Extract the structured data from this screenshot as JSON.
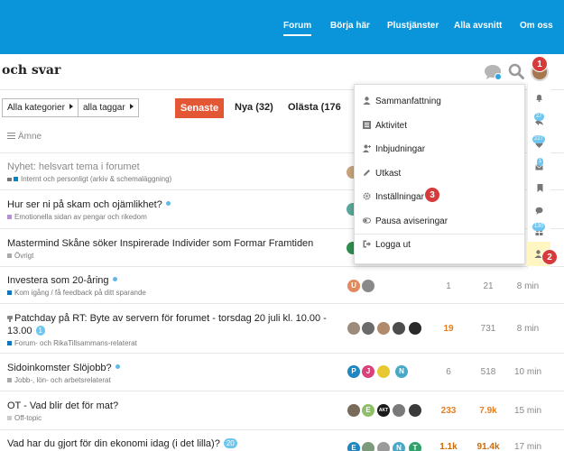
{
  "nav": {
    "links": [
      "Forum",
      "Börja här",
      "Plustjänster",
      "Alla avsnitt",
      "Om oss"
    ]
  },
  "header": {
    "site_title": "och svar"
  },
  "filters": {
    "categories": "Alla kategorier",
    "tags": "alla taggar"
  },
  "tabs": {
    "latest": "Senaste",
    "new": "Nya (32)",
    "unread": "Olästa (176"
  },
  "columns": {
    "topic": "Ämne"
  },
  "topics": [
    {
      "title": "Nyhet: helsvart tema i forumet",
      "category": "Internt och personligt (arkiv & schemaläggning)",
      "category_color": "#0088cc",
      "muted": true
    },
    {
      "title": "Hur ser ni på skam och ojämlikhet?",
      "category": "Emotionella sidan av pengar och rikedom",
      "category_color": "#b491d1"
    },
    {
      "title": "Mastermind Skåne söker Inspirerade Individer som Formar Framtiden",
      "category": "Övrigt",
      "category_color": "#aaaaaa"
    },
    {
      "title": "Investera som 20-åring",
      "category": "Kom igång / få feedback på ditt sparande",
      "category_color": "#0e76bd",
      "replies": "1",
      "views": "21",
      "activity": "8 min",
      "avatars": [
        "U",
        ""
      ]
    },
    {
      "title_line1": "Patchday på RT: Byte av servern för forumet - torsdag 20 juli kl. 10.00 -",
      "title_line2": "13.00",
      "badge": "1",
      "category": "Forum- och RikaTillsammans-relaterat",
      "category_color": "#0e76bd",
      "replies": "19",
      "views": "731",
      "activity": "8 min"
    },
    {
      "title": "Sidoinkomster Slöjobb?",
      "category": "Jobb-, lön- och arbetsrelaterat",
      "category_color": "#aaaaaa",
      "replies": "6",
      "views": "518",
      "activity": "10 min",
      "avatars": [
        "P",
        "J",
        "",
        "N"
      ]
    },
    {
      "title": "OT - Vad blir det för mat?",
      "category": "Off-topic",
      "category_color": "#cccccc",
      "replies": "233",
      "views": "7.9k",
      "activity": "15 min",
      "avatars": [
        "",
        "E",
        "AKT",
        "",
        ""
      ]
    },
    {
      "title": "Vad har du gjort för din ekonomi idag (i det lilla)?",
      "badge": "20",
      "replies": "1.1k",
      "views": "91.4k",
      "activity": "17 min",
      "avatars": [
        "E",
        "",
        "",
        "N",
        "T"
      ]
    }
  ],
  "user_menu": {
    "items": [
      "Sammanfattning",
      "Aktivitet",
      "Inbjudningar",
      "Utkast",
      "Inställningar",
      "Pausa aviseringar",
      "Logga ut"
    ]
  },
  "strip": {
    "badges": [
      "27",
      "227",
      "1",
      "130"
    ]
  },
  "markers": [
    "1",
    "2",
    "3"
  ],
  "colors": {
    "nav_blue": "#0a94d9",
    "accent_orange": "#e45735",
    "marker_red": "#d73a3a"
  }
}
